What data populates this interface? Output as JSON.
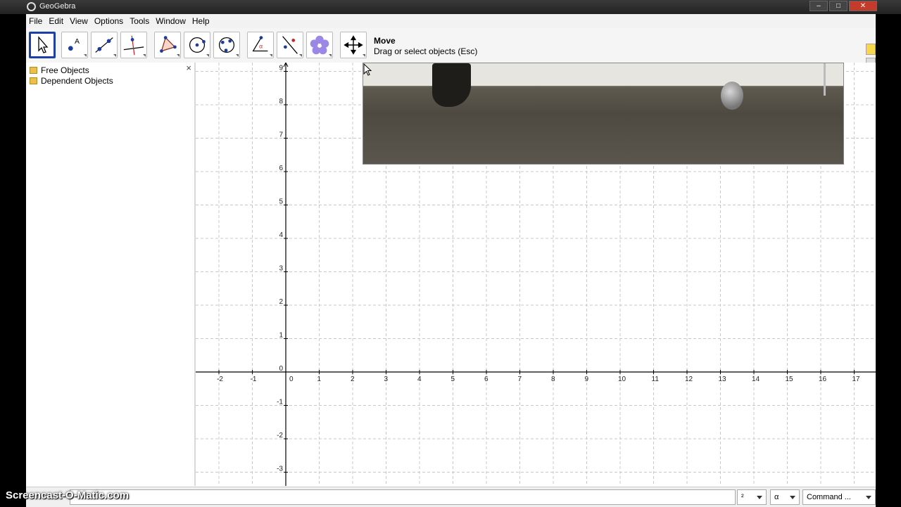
{
  "window": {
    "title": "GeoGebra"
  },
  "menu": [
    "File",
    "Edit",
    "View",
    "Options",
    "Tools",
    "Window",
    "Help"
  ],
  "toolbar": {
    "tools": [
      "move-tool",
      "point-tool",
      "line-tool",
      "perpendicular-line-tool",
      "polygon-tool",
      "circle-tool",
      "conic-tool",
      "angle-tool",
      "reflect-tool",
      "slider-tool",
      "move-graphics-view-tool"
    ],
    "active_tool_name": "Move",
    "active_tool_help": "Drag or select objects (Esc)"
  },
  "algebra": {
    "close": "×",
    "items": [
      {
        "label": "Free Objects"
      },
      {
        "label": "Dependent Objects"
      }
    ]
  },
  "graphics": {
    "x_ticks": [
      "-2",
      "-1",
      "0",
      "1",
      "2",
      "3",
      "4",
      "5",
      "6",
      "7",
      "8",
      "9",
      "10",
      "11",
      "12",
      "13",
      "14",
      "15",
      "16",
      "17"
    ],
    "y_ticks": [
      "9",
      "8",
      "7",
      "6",
      "5",
      "4",
      "3",
      "2",
      "1",
      "0",
      "-1",
      "-2",
      "-3"
    ]
  },
  "inputbar": {
    "exponent_dropdown": "²",
    "greek_dropdown": "α",
    "command_dropdown": "Command ..."
  },
  "watermark": "Screencast-O-Matic.com"
}
